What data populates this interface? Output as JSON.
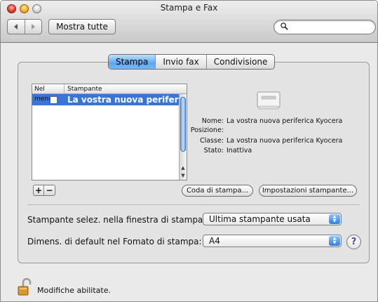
{
  "window": {
    "title": "Stampa e Fax"
  },
  "toolbar": {
    "back_icon": "left-arrow-icon",
    "forward_icon": "right-arrow-icon",
    "show_all_label": "Mostra tutte",
    "search_placeholder": ""
  },
  "tabs": [
    {
      "label": "Stampa",
      "active": true
    },
    {
      "label": "Invio fax",
      "active": false
    },
    {
      "label": "Condivisione",
      "active": false
    }
  ],
  "printer_list": {
    "columns": [
      "Nel menu",
      "Stampante"
    ],
    "rows": [
      {
        "in_menu": false,
        "name": "La vostra nuova periferica Kyocera",
        "selected": true
      }
    ]
  },
  "printer_info": {
    "name_label": "Nome:",
    "name_value": "La vostra nuova periferica Kyocera",
    "position_label": "Posizione:",
    "position_value": "",
    "class_label": "Classe:",
    "class_value": "La vostra nuova periferica Kyocera",
    "status_label": "Stato:",
    "status_value": "Inattiva"
  },
  "buttons": {
    "add": "+",
    "remove": "−",
    "queue": "Coda di stampa...",
    "settings": "Impostazioni stampante..."
  },
  "preferences": {
    "selected_printer_label": "Stampante selez. nella finestra di stampa:",
    "selected_printer_value": "Ultima stampante usata",
    "paper_size_label": "Dimens. di default nel Fomato di stampa:",
    "paper_size_value": "A4",
    "help_label": "?"
  },
  "lock": {
    "text": "Modifiche abilitate.",
    "icon": "unlocked-padlock-icon"
  },
  "colors": {
    "selection": "#3875d7",
    "tab_active": "#5aa8f0"
  }
}
